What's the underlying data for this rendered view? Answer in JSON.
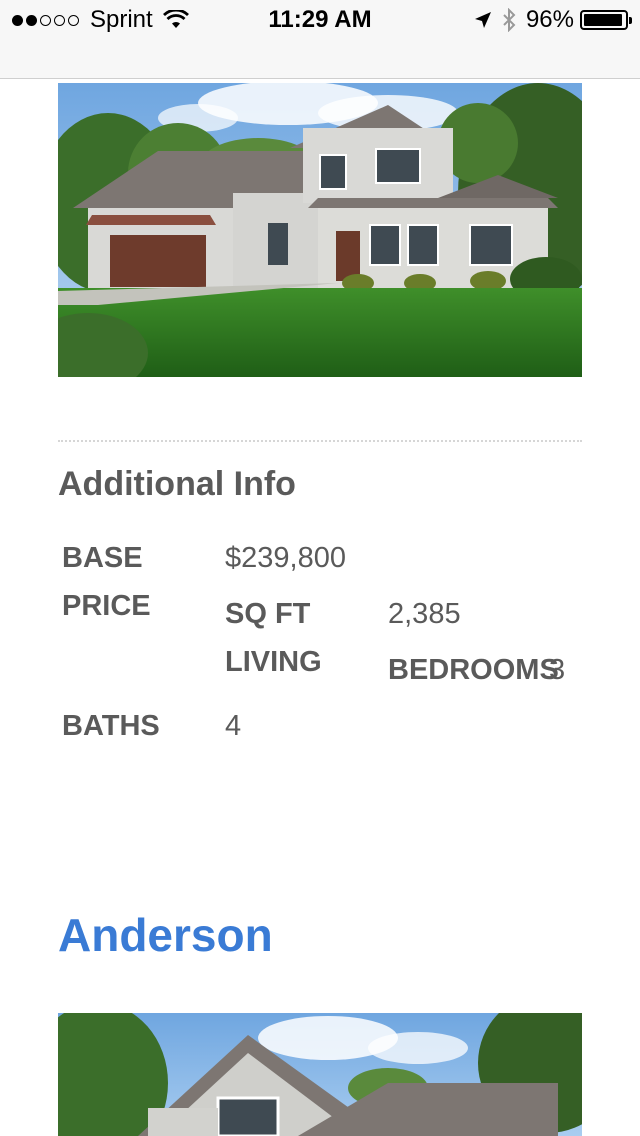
{
  "status_bar": {
    "signal_filled": 2,
    "signal_total": 5,
    "carrier": "Sprint",
    "time": "11:29 AM",
    "battery_percent": "96%",
    "battery_level": 0.96,
    "icons": [
      "wifi-icon",
      "location-arrow-icon",
      "bluetooth-icon",
      "battery-icon"
    ]
  },
  "additional_info": {
    "title": "Additional Info",
    "base_price_label_1": "BASE",
    "base_price_label_2": "PRICE",
    "base_price_value": "$239,800",
    "sqft_label_1": "SQ FT",
    "sqft_label_2": "LIVING",
    "sqft_value": "2,385",
    "bedrooms_label": "BEDROOMS",
    "bedrooms_value": "3",
    "baths_label": "BATHS",
    "baths_value": "4"
  },
  "next_plan": {
    "name": "Anderson"
  },
  "colors": {
    "plan_name": "#3a7bd5",
    "text": "#5a5a5a"
  }
}
